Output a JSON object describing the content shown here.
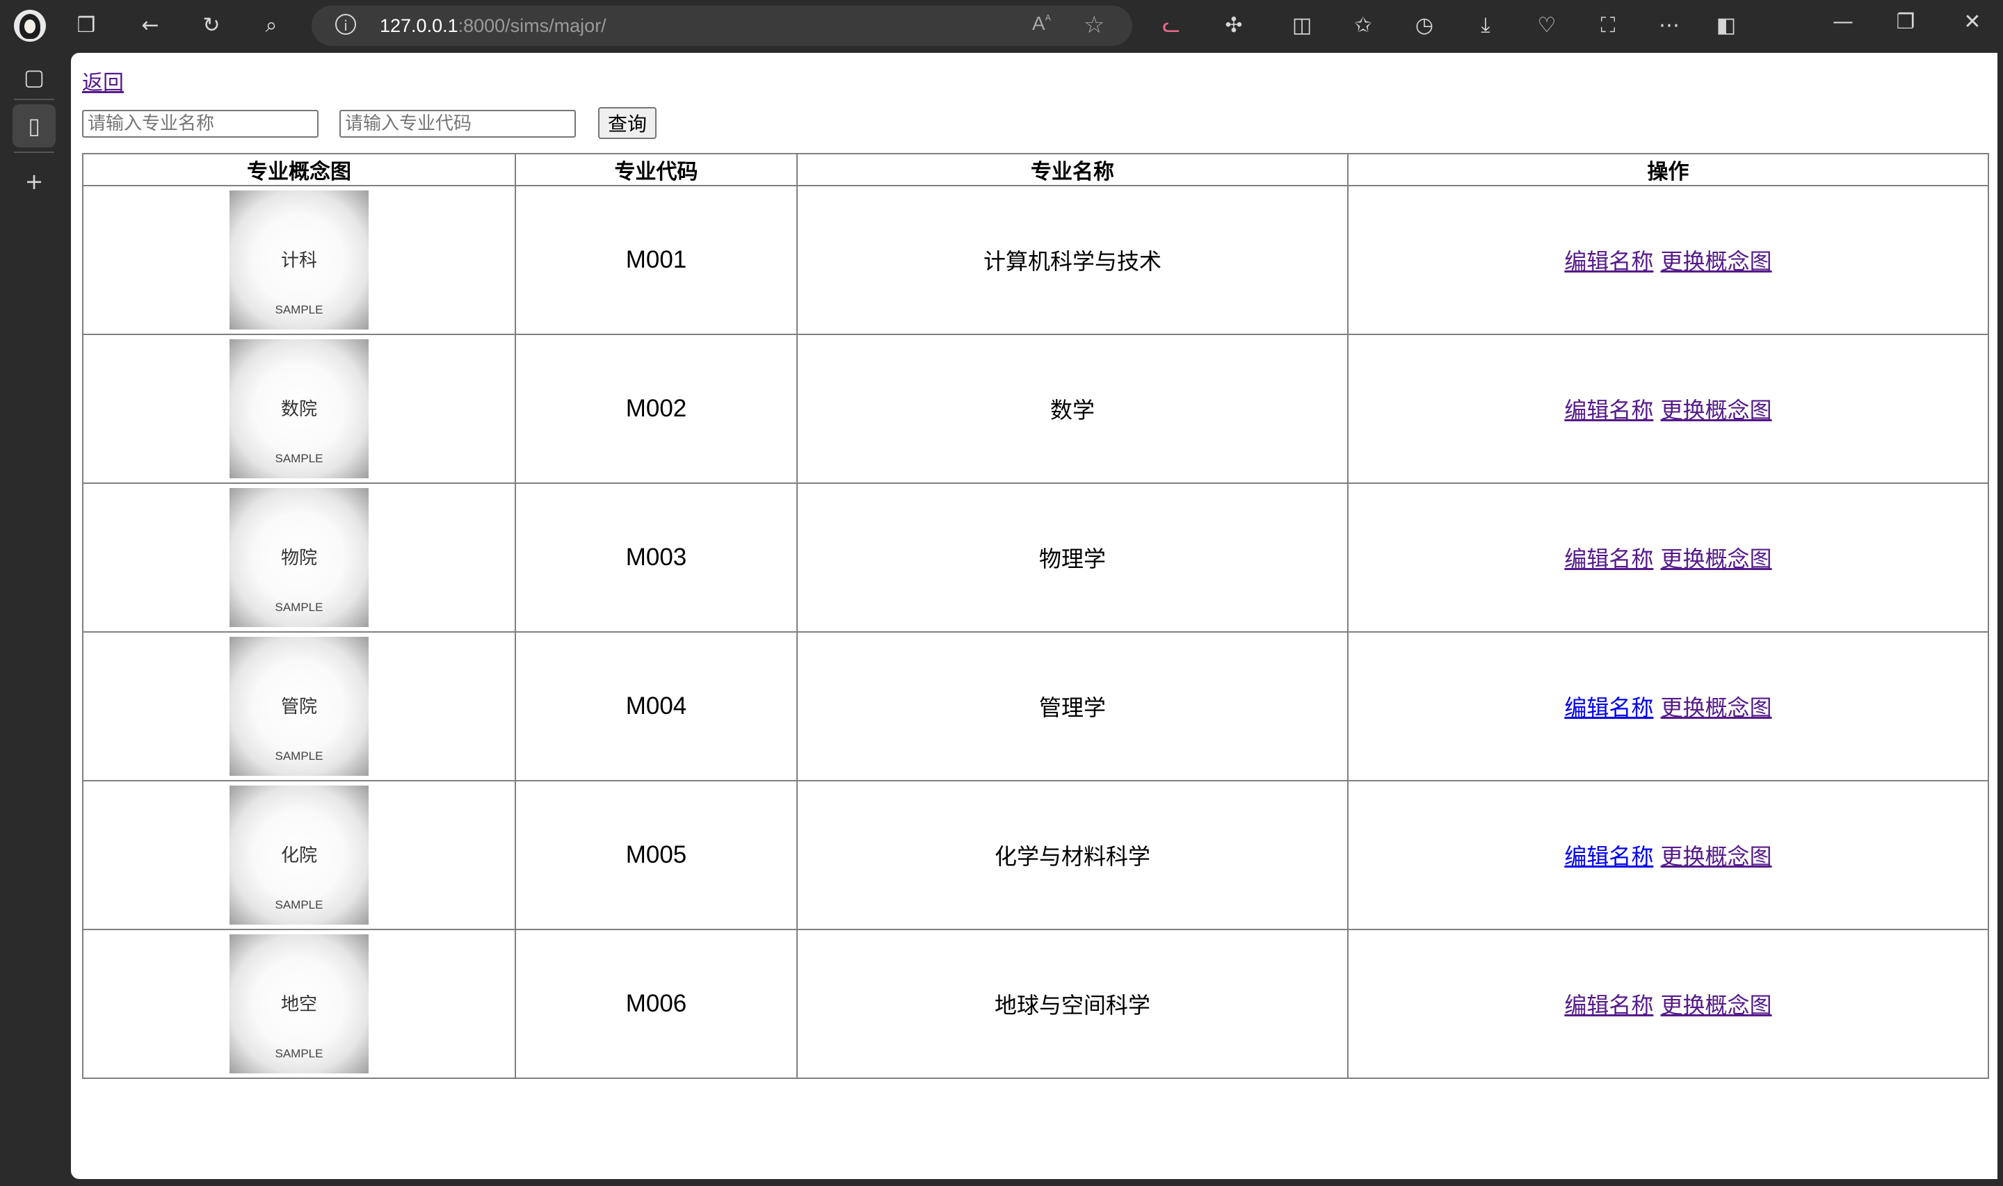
{
  "browser": {
    "url_host": "127.0.0.1",
    "url_rest": ":8000/sims/major/",
    "read_aloud_glyph": "Aᴬ"
  },
  "page": {
    "back_label": "返回",
    "search": {
      "name_placeholder": "请输入专业名称",
      "code_placeholder": "请输入专业代码",
      "query_label": "查询"
    },
    "table": {
      "headers": [
        "专业概念图",
        "专业代码",
        "专业名称",
        "操作"
      ],
      "sample_text": "SAMPLE",
      "edit_label": "编辑名称",
      "change_image_label": "更换概念图",
      "rows": [
        {
          "thumb_label": "计科",
          "code": "M001",
          "name": "计算机科学与技术"
        },
        {
          "thumb_label": "数院",
          "code": "M002",
          "name": "数学"
        },
        {
          "thumb_label": "物院",
          "code": "M003",
          "name": "物理学"
        },
        {
          "thumb_label": "管院",
          "code": "M004",
          "name": "管理学"
        },
        {
          "thumb_label": "化院",
          "code": "M005",
          "name": "化学与材料科学"
        },
        {
          "thumb_label": "地空",
          "code": "M006",
          "name": "地球与空间科学"
        }
      ]
    }
  },
  "colors": {
    "visited_link": "#551a8b",
    "unvisited_link": "#0000ee",
    "chrome_bg": "#2b2b2b"
  }
}
